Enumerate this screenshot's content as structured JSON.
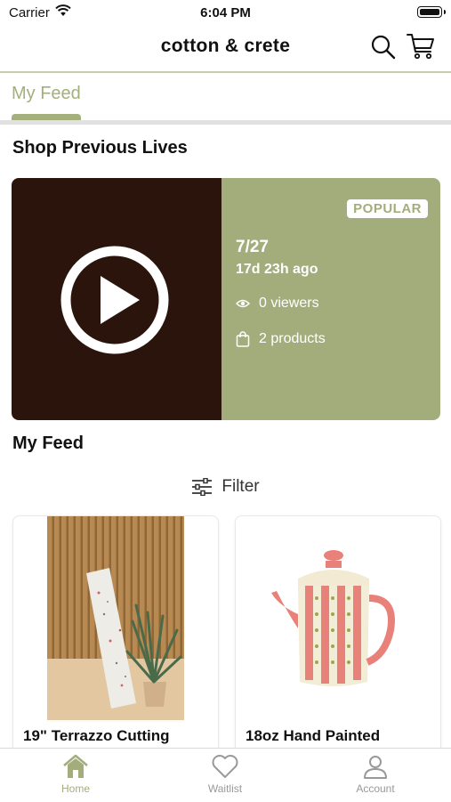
{
  "status_bar": {
    "carrier": "Carrier",
    "time": "6:04 PM"
  },
  "header": {
    "title": "cotton & crete",
    "icons": [
      "search-icon",
      "cart-icon"
    ]
  },
  "tabs": [
    {
      "label": "My Feed",
      "active": true
    }
  ],
  "previous_lives": {
    "title": "Shop Previous Lives",
    "card": {
      "badge": "POPULAR",
      "date": "7/27",
      "ago": "17d 23h ago",
      "viewers": "0 viewers",
      "products": "2 products"
    }
  },
  "feed": {
    "title": "My Feed",
    "filter_label": "Filter",
    "products": [
      {
        "title": "19\" Terrazzo Cutting"
      },
      {
        "title": "18oz Hand Painted"
      }
    ]
  },
  "bottom_nav": [
    {
      "label": "Home",
      "icon": "home-icon",
      "active": true
    },
    {
      "label": "Waitlist",
      "icon": "heart-icon",
      "active": false
    },
    {
      "label": "Account",
      "icon": "user-icon",
      "active": false
    }
  ],
  "colors": {
    "accent": "#a3ad7c",
    "video_bg": "#2a140b",
    "tab_accent": "#a3b07c"
  }
}
